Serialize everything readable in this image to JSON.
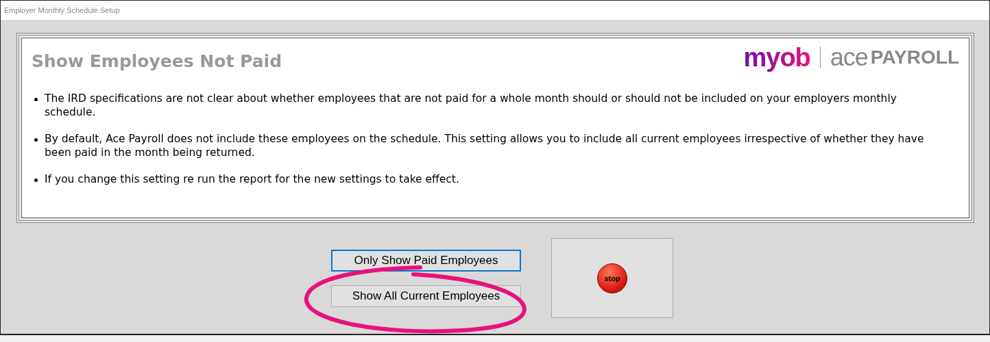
{
  "window": {
    "title": "Employer Monthly Schedule Setup"
  },
  "panel": {
    "heading": "Show Employees Not Paid",
    "logo": {
      "brand": "myob",
      "product_light": "ace",
      "product_bold": "PAYROLL"
    },
    "bullets": [
      "The IRD specifications are not clear about whether employees that are not paid for a whole month should or should not be included on your employers monthly schedule.",
      "By default, Ace Payroll does not include these employees on the schedule. This setting allows you to include all current employees irrespective of whether they have been paid in the month being returned.",
      "If you change this setting re run the report for the new settings to take effect."
    ]
  },
  "buttons": [
    {
      "label": "Only Show Paid Employees",
      "focused": true
    },
    {
      "label": "Show All Current Employees",
      "focused": false
    }
  ],
  "stop": {
    "label": "stop"
  }
}
